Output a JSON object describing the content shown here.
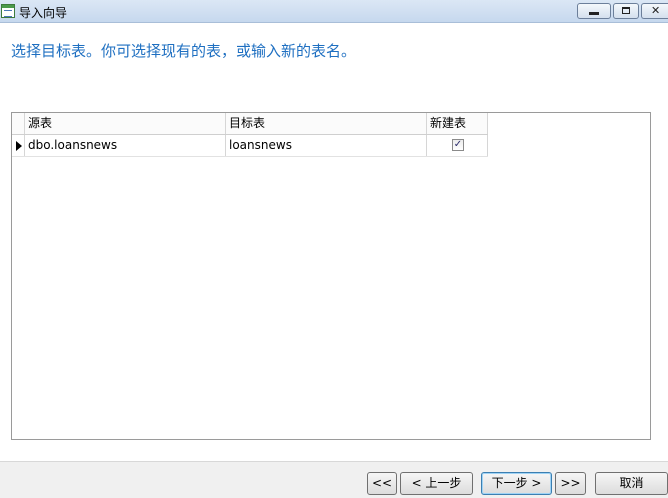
{
  "window": {
    "title": "导入向导"
  },
  "instruction": "选择目标表。你可选择现有的表，或输入新的表名。",
  "grid": {
    "columns": [
      "源表",
      "目标表",
      "新建表"
    ],
    "rows": [
      {
        "source": "dbo.loansnews",
        "target": "loansnews",
        "new_table": true
      }
    ]
  },
  "footer": {
    "first_label": "<<",
    "prev_label": "< 上一步",
    "next_label": "下一步 >",
    "last_label": ">>",
    "cancel_label": "取消"
  },
  "icons": {
    "app": "table-import-icon",
    "minimize": "minimize-icon",
    "maximize": "maximize-icon",
    "close": "close-icon",
    "row_indicator": "row-pointer-icon",
    "checkbox": "checkmark-icon"
  }
}
